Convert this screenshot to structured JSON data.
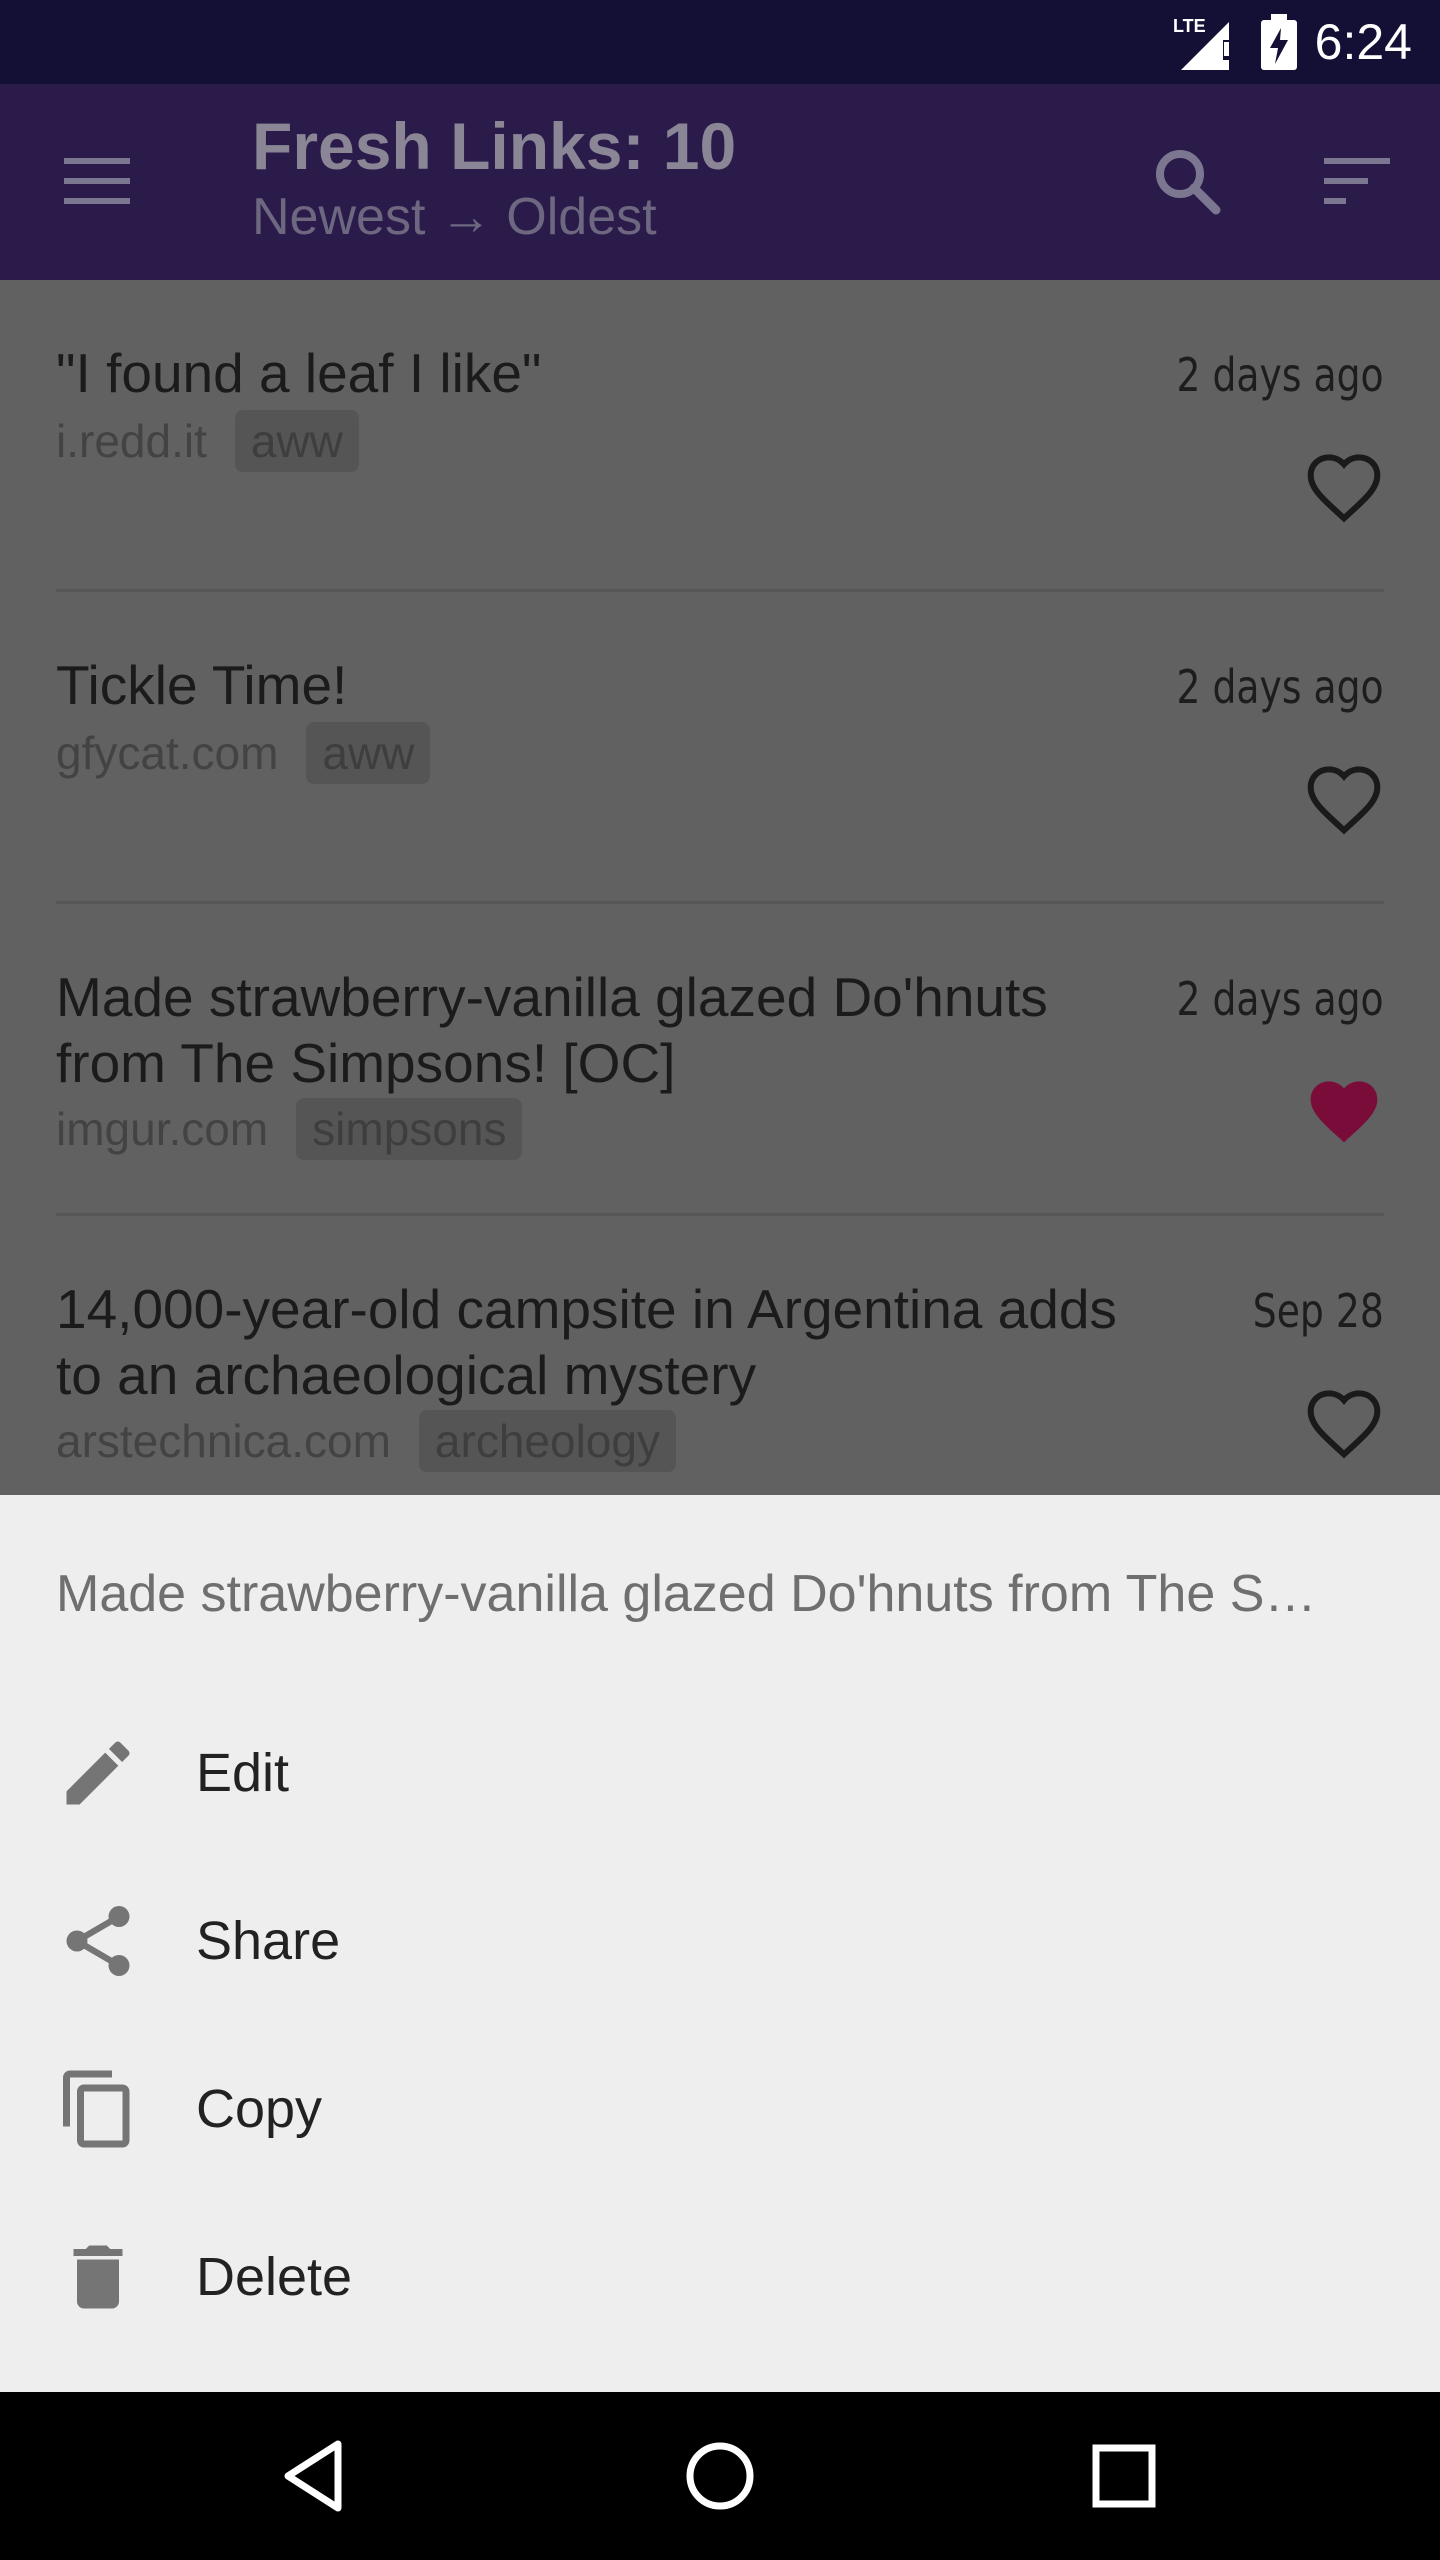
{
  "status_bar": {
    "network": "LTE",
    "time": "6:24"
  },
  "app_bar": {
    "title": "Fresh Links: 10",
    "subtitle": "Newest → Oldest",
    "icons": [
      "menu-icon",
      "search-icon",
      "sort-icon"
    ]
  },
  "links": [
    {
      "title": "\"I found a leaf I like\"",
      "domain": "i.redd.it",
      "tag": "aww",
      "time": "2 days ago",
      "favorited": false
    },
    {
      "title": "Tickle Time!",
      "domain": "gfycat.com",
      "tag": "aww",
      "time": "2 days ago",
      "favorited": false
    },
    {
      "title": "Made strawberry-vanilla glazed Do'hnuts from The Simpsons! [OC]",
      "domain": "imgur.com",
      "tag": "simpsons",
      "time": "2 days ago",
      "favorited": true
    },
    {
      "title": "14,000-year-old campsite in Argentina adds to an archaeological mystery",
      "domain": "arstechnica.com",
      "tag": "archeology",
      "time": "Sep 28",
      "favorited": false
    }
  ],
  "bottom_sheet": {
    "title": "Made strawberry-vanilla glazed Do'hnuts from The S…",
    "items": [
      {
        "label": "Edit",
        "icon": "edit-icon"
      },
      {
        "label": "Share",
        "icon": "share-icon"
      },
      {
        "label": "Copy",
        "icon": "copy-icon"
      },
      {
        "label": "Delete",
        "icon": "delete-icon"
      }
    ]
  },
  "nav_bar": {
    "icons": [
      "back-icon",
      "home-icon",
      "recents-icon"
    ]
  },
  "colors": {
    "status_bar": "#140f34",
    "app_bar": "#2b1b4b",
    "scrim_list": "#616161",
    "favorite_heart": "#7a0c3a",
    "sheet": "#eeeeee"
  }
}
